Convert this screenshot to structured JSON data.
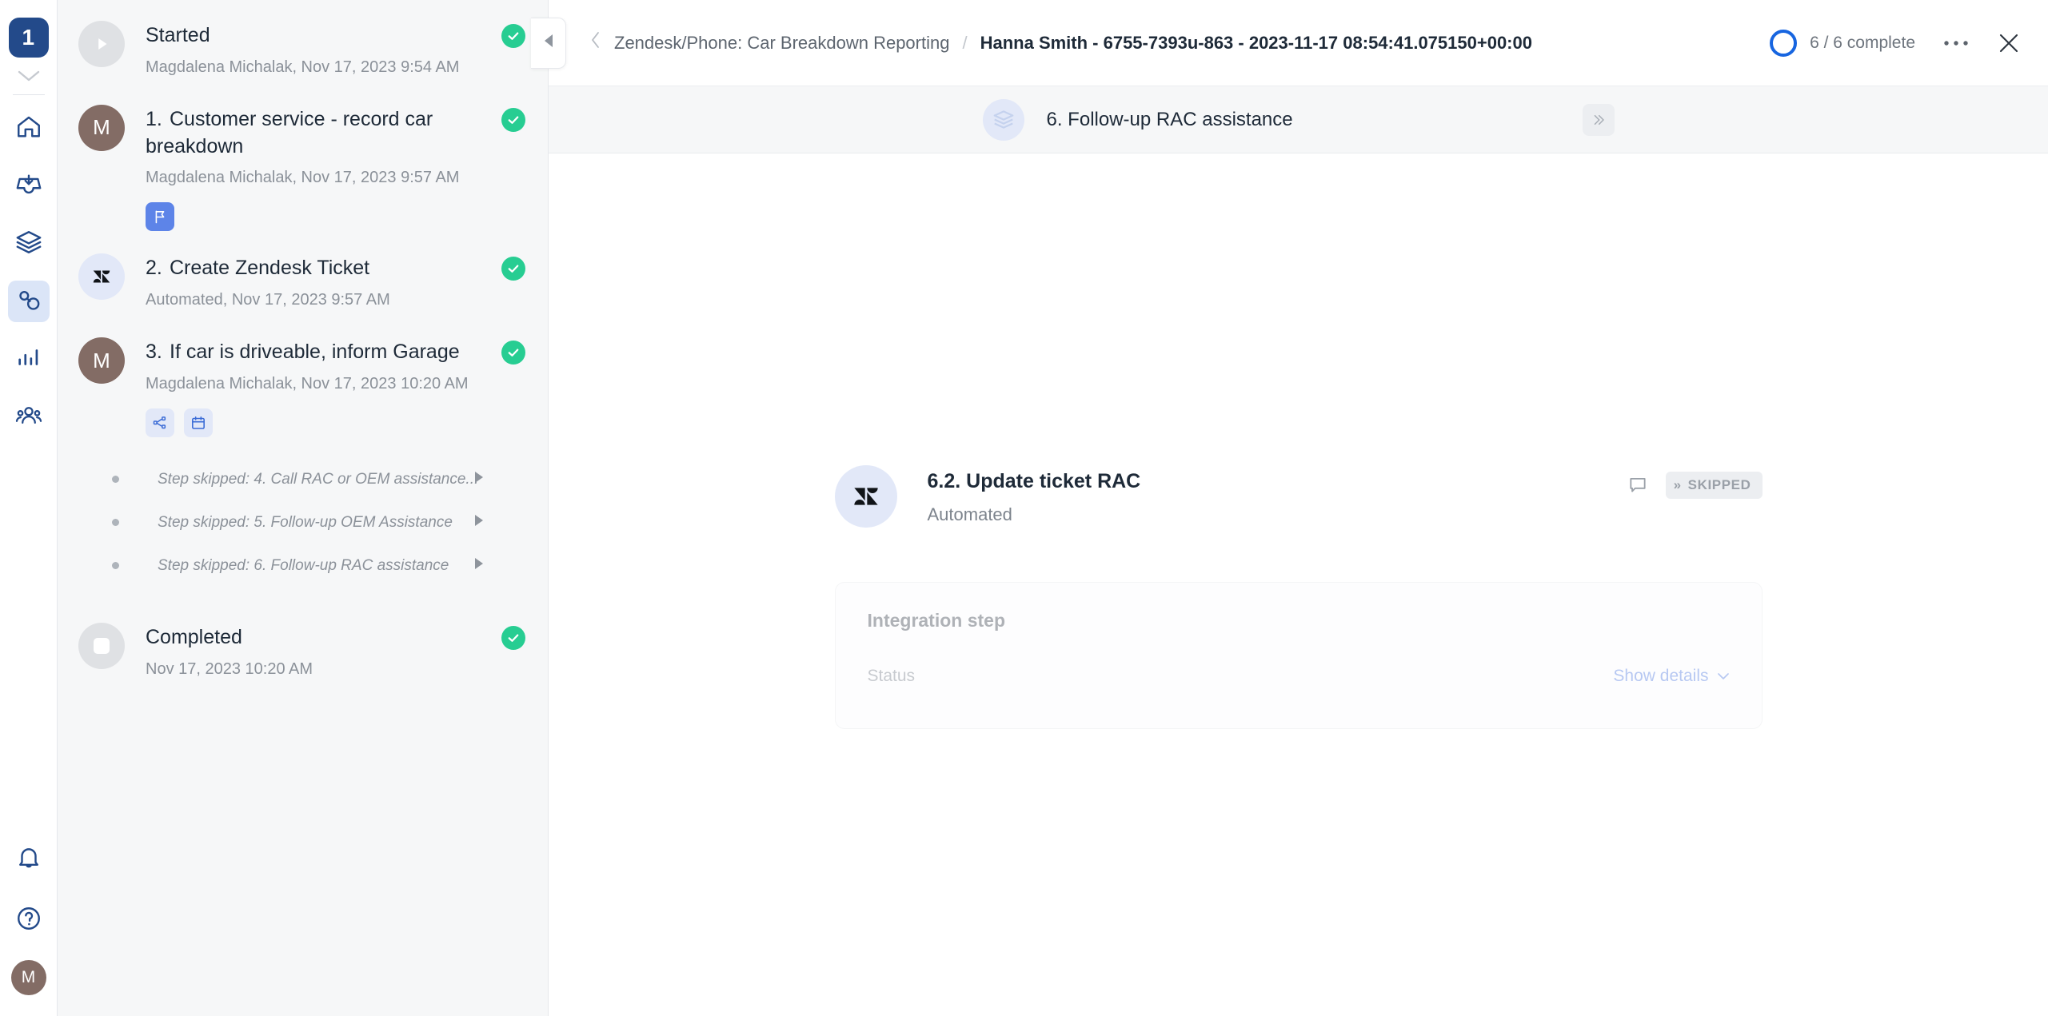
{
  "rail": {
    "logo_label": "1",
    "items": [
      {
        "name": "home-icon",
        "label": "Home",
        "active": false
      },
      {
        "name": "inbox-icon",
        "label": "Inbox",
        "active": false
      },
      {
        "name": "layers-icon",
        "label": "Templates",
        "active": false
      },
      {
        "name": "workflow-icon",
        "label": "Workflow runs",
        "active": true
      },
      {
        "name": "chart-bars-icon",
        "label": "Reports",
        "active": false
      },
      {
        "name": "people-icon",
        "label": "People",
        "active": false
      }
    ],
    "bottom": [
      {
        "name": "bell-icon",
        "label": "Notifications"
      },
      {
        "name": "help-icon",
        "label": "Help"
      }
    ],
    "avatar_initial": "M"
  },
  "timeline": {
    "items": [
      {
        "kind": "started",
        "avatar": "play",
        "title": "Started",
        "subtitle": "Magdalena Michalak, Nov 17, 2023 9:54 AM",
        "checked": true,
        "tags": []
      },
      {
        "kind": "step",
        "avatar": "person",
        "avatar_initial": "M",
        "number": "1.",
        "title": "Customer service - record car breakdown",
        "subtitle": "Magdalena Michalak, Nov 17, 2023 9:57 AM",
        "checked": true,
        "tags": [
          {
            "name": "flag-icon",
            "style": "solid"
          }
        ]
      },
      {
        "kind": "step",
        "avatar": "zendesk",
        "number": "2.",
        "title": "Create Zendesk Ticket",
        "subtitle": "Automated, Nov 17, 2023 9:57 AM",
        "checked": true,
        "tags": []
      },
      {
        "kind": "step",
        "avatar": "person",
        "avatar_initial": "M",
        "number": "3.",
        "title": "If car is driveable, inform Garage",
        "subtitle": "Magdalena Michalak, Nov 17, 2023 10:20 AM",
        "checked": true,
        "tags": [
          {
            "name": "nodes-icon",
            "style": "light"
          },
          {
            "name": "calendar-icon",
            "style": "light"
          }
        ]
      }
    ],
    "skipped": [
      {
        "text": "Step skipped: 4. Call RAC or OEM assistance..."
      },
      {
        "text": "Step skipped: 5. Follow-up OEM Assistance"
      },
      {
        "text": "Step skipped: 6. Follow-up RAC assistance"
      }
    ],
    "completed": {
      "title": "Completed",
      "subtitle": "Nov 17, 2023 10:20 AM",
      "checked": true
    }
  },
  "topbar": {
    "breadcrumb_parent": "Zendesk/Phone: Car Breakdown Reporting",
    "breadcrumb_separator": "/",
    "breadcrumb_current": "Hanna Smith - 6755-7393u-863 - 2023-11-17 08:54:41.075150+00:00",
    "progress_text": "6 / 6 complete",
    "progress_color": "#1765e0",
    "more_label": "•••",
    "close_label": "✕"
  },
  "step_strip": {
    "title": "6. Follow-up RAC assistance",
    "next_label": "»"
  },
  "detail": {
    "title": "6.2. Update ticket RAC",
    "subtitle": "Automated",
    "status_badge": "SKIPPED",
    "status_badge_prefix": "»",
    "card": {
      "title": "Integration step",
      "status_label": "Status",
      "show_details_label": "Show details",
      "chevron": "⌄"
    }
  }
}
